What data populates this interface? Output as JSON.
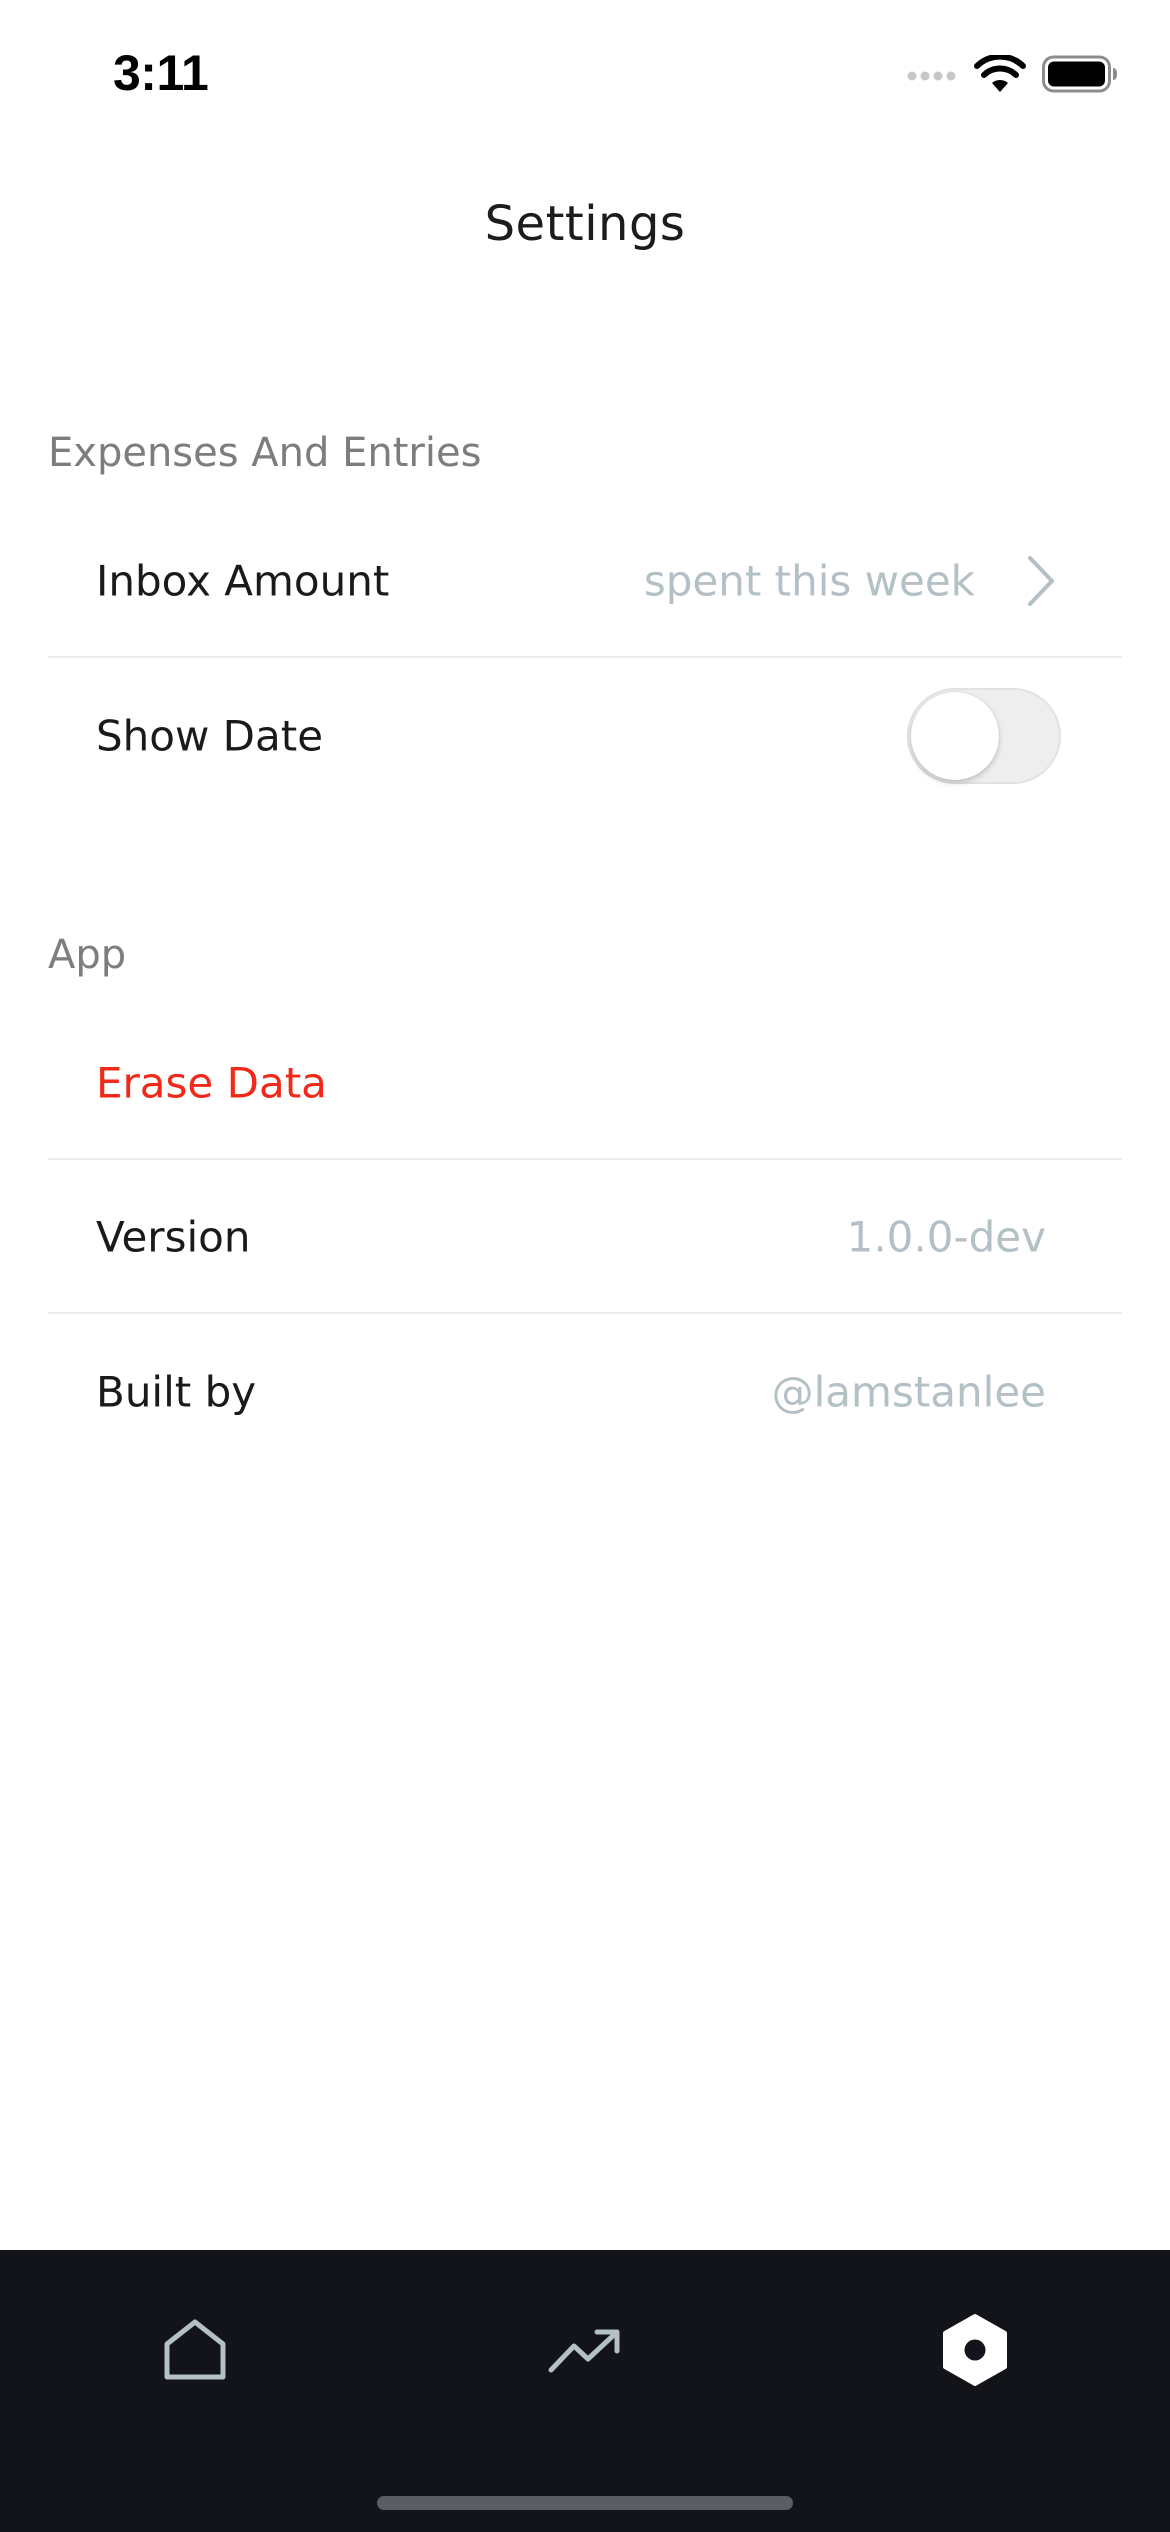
{
  "status_bar": {
    "time": "3:11",
    "icons": [
      "cellular-signal-icon",
      "wifi-icon",
      "battery-icon"
    ]
  },
  "page": {
    "title": "Settings"
  },
  "sections": {
    "expenses": {
      "header": "Expenses And Entries",
      "inbox_amount": {
        "label": "Inbox Amount",
        "value": "spent this week",
        "icon": "chevron-right-icon"
      },
      "show_date": {
        "label": "Show Date",
        "toggle_on": false
      }
    },
    "app": {
      "header": "App",
      "erase_data": {
        "label": "Erase Data"
      },
      "version": {
        "label": "Version",
        "value": "1.0.0-dev"
      },
      "built_by": {
        "label": "Built by",
        "value": "@lamstanlee"
      }
    }
  },
  "tab_bar": {
    "tabs": [
      {
        "icon": "home-icon",
        "active": false
      },
      {
        "icon": "trending-up-icon",
        "active": false
      },
      {
        "icon": "settings-hex-icon",
        "active": true
      }
    ]
  },
  "colors": {
    "accent_danger": "#f0291a",
    "muted_value": "#b3c0c6",
    "section_header": "#7d7d7d",
    "tab_bar_bg": "#12141a",
    "tab_inactive": "#b3c0c6",
    "tab_active": "#ffffff"
  }
}
